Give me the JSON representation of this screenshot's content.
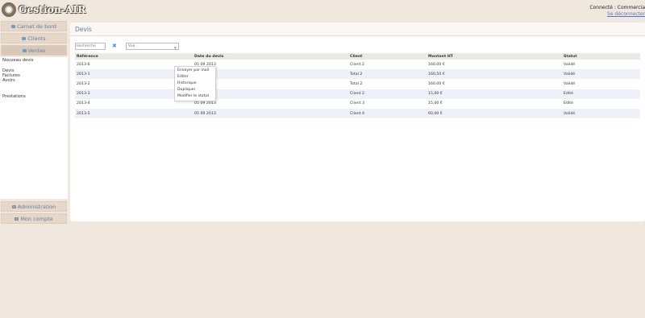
{
  "header": {
    "logo_text": "Gestion-AIR",
    "user_status": "Connecté : Commercia",
    "logout": "Se déconnecter"
  },
  "sidebar": {
    "carnet": "Carnet de bord",
    "clients": "Clients",
    "ventes": "Ventes",
    "submenu": [
      "Nouveau devis",
      "Devis",
      "Factures",
      "Avoirs",
      "Prestations"
    ],
    "administration": "Administration",
    "mon_compte": "Mon compte"
  },
  "panel": {
    "title": "Devis",
    "search_placeholder": "Recherche",
    "clear_symbol": "✖",
    "view_select": "Vue :"
  },
  "table": {
    "headers": [
      "Référence",
      "Date du devis",
      "Client",
      "Montant HT",
      "Statut"
    ],
    "rows": [
      [
        "2013-6",
        "05 09 2013",
        "Client 2",
        "160,00 €",
        "Validé"
      ],
      [
        "2013-1",
        "",
        "Total 2",
        "160,50 €",
        "Validé"
      ],
      [
        "2013-2",
        "",
        "Total 2",
        "160,00 €",
        "Validé"
      ],
      [
        "2013-3",
        "",
        "Client 2",
        "15,00 €",
        "Edité"
      ],
      [
        "2013-4",
        "05 09 2013",
        "Client 3",
        "15,00 €",
        "Edité"
      ],
      [
        "2013-5",
        "05 09 2013",
        "Client 4",
        "60,00 €",
        "Validé"
      ]
    ]
  },
  "context_menu": [
    "Envoyer par mail",
    "Editer",
    "Historique",
    "Dupliquer",
    "Modifier le statut"
  ],
  "colors": {
    "accent": "#5f7fa8",
    "background": "#f0e8df",
    "row_alt": "#eef2f8"
  }
}
